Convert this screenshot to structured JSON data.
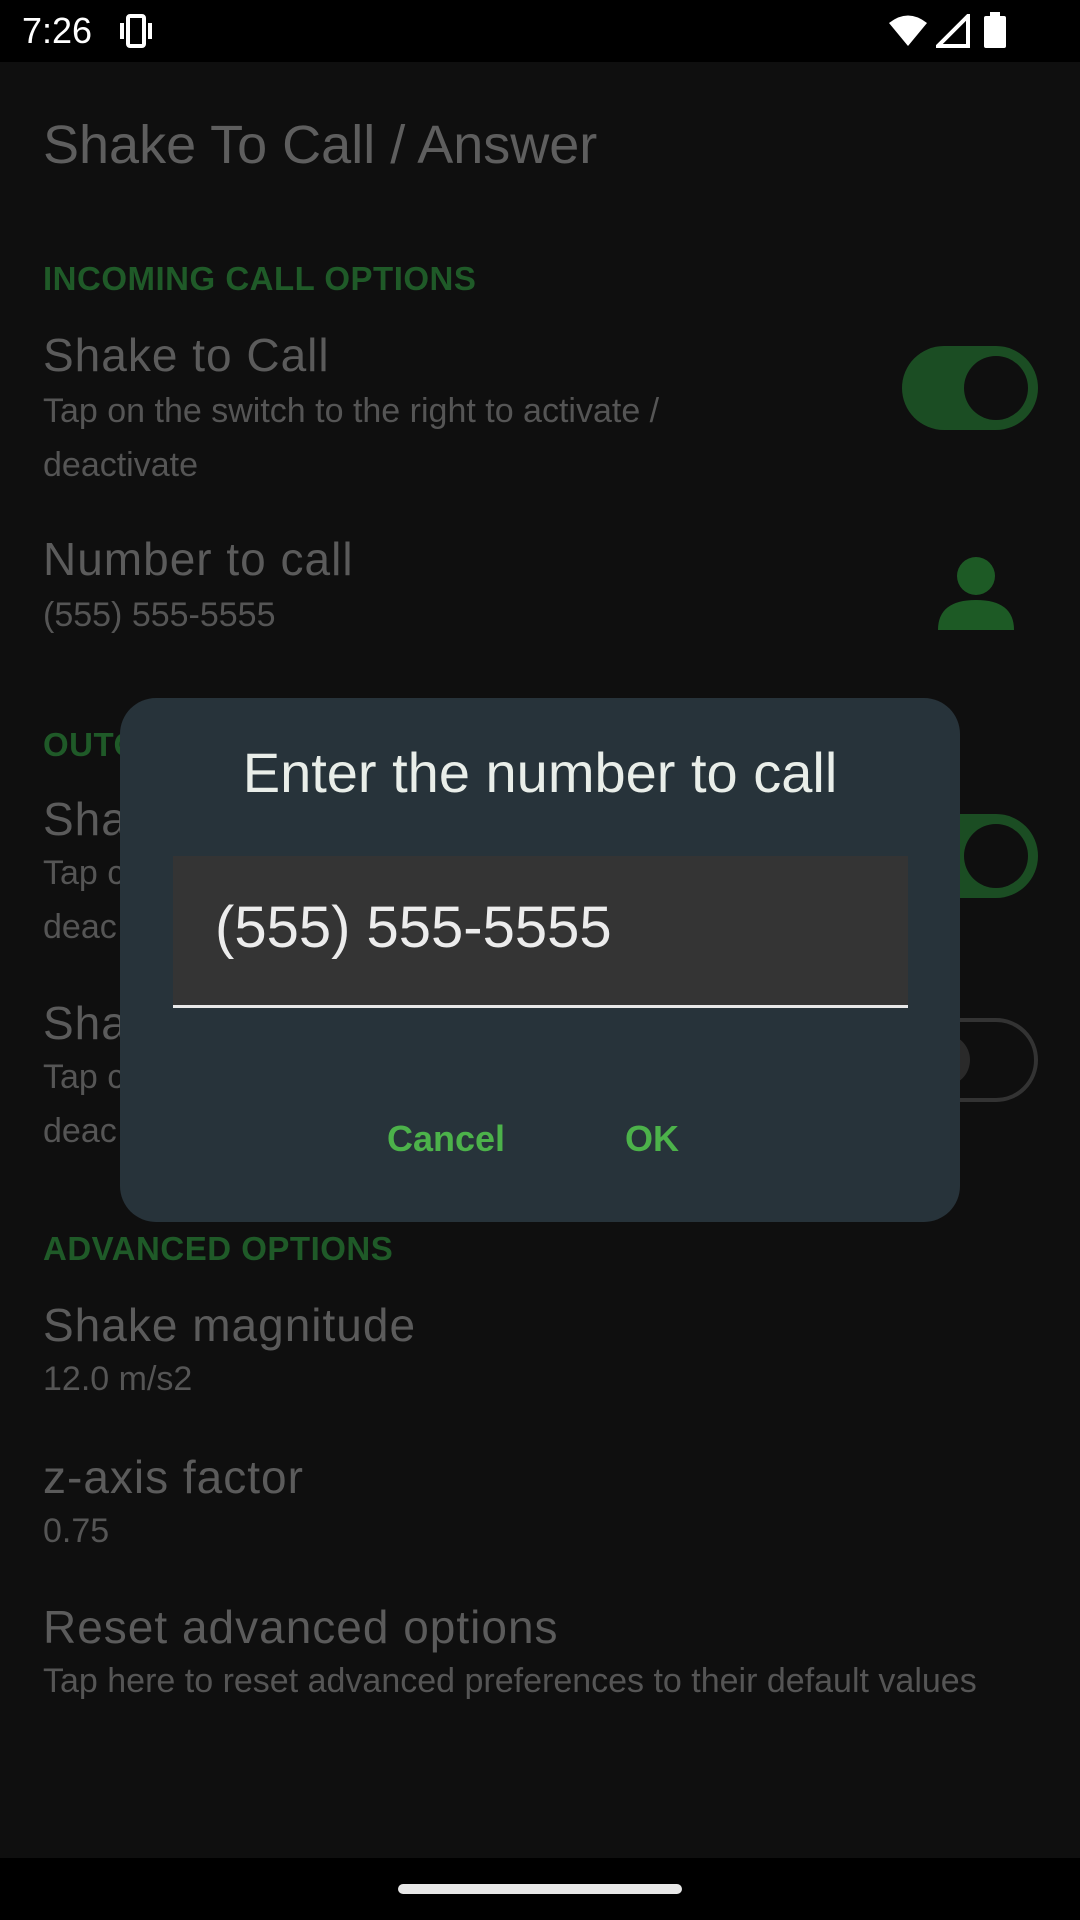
{
  "status_bar": {
    "time": "7:26",
    "icons": [
      "vibrate-icon",
      "wifi-icon",
      "cellular-signal-icon",
      "battery-icon"
    ]
  },
  "app": {
    "title": "Shake To Call / Answer"
  },
  "sections": {
    "incoming": {
      "header": "INCOMING CALL OPTIONS"
    },
    "outgoing": {
      "header_visible": "OUTO"
    },
    "advanced": {
      "header": "ADVANCED OPTIONS"
    }
  },
  "prefs": {
    "shake_to_call": {
      "title": "Shake to Call",
      "summary": "Tap on the switch to the right to activate / deactivate",
      "enabled": true
    },
    "number_to_call": {
      "title": "Number to call",
      "summary": "(555) 555-5555",
      "icon": "contact-person-icon"
    },
    "outgoing_1": {
      "title_visible": "Sha",
      "summary_line1": "Tap c",
      "summary_line2": "deac",
      "enabled": true
    },
    "outgoing_2": {
      "title_visible": "Sha",
      "summary_line1": "Tap c",
      "summary_line2": "deac",
      "enabled": false
    },
    "shake_magnitude": {
      "title": "Shake magnitude",
      "summary": "12.0 m/s2"
    },
    "z_axis_factor": {
      "title": "z-axis factor",
      "summary": "0.75"
    },
    "reset_advanced": {
      "title": "Reset advanced options",
      "summary": "Tap here to reset advanced preferences to their default values"
    }
  },
  "dialog": {
    "title": "Enter the number to call",
    "input_value": "(555) 555-5555",
    "cancel_label": "Cancel",
    "ok_label": "OK"
  },
  "colors": {
    "accent": "#4cb24a",
    "dialog_bg": "#27333a",
    "section_header": "#1f5a28"
  }
}
